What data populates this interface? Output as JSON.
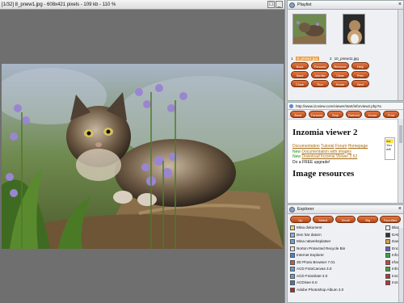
{
  "viewer": {
    "title": "[1/32] 8_pnew1.jpg - 608x421 pixels - 109 kb - 110 %"
  },
  "playlist": {
    "title": "Playlist",
    "thumbs": [
      {
        "index": "1",
        "name": "8_pnew1.jpg",
        "selected": true
      },
      {
        "index": "2",
        "name": "10_pnew11.jpg",
        "selected": false
      }
    ],
    "buttons_row1": [
      "Back",
      "Forward",
      "Remove",
      "Help"
    ],
    "buttons_row2": [
      "Save",
      "Add file",
      "Clear",
      "Prev"
    ],
    "buttons_row3": [
      "Close",
      "Run",
      "Home",
      "Next"
    ]
  },
  "browser": {
    "url": "http://www.izoview.com/viewer/start/inforview2.php?a",
    "nav_buttons": [
      "Back",
      "Forward",
      "Stop",
      "Refresh",
      "Home",
      "Print"
    ],
    "heading": "Inzomia viewer 2",
    "links_line1": [
      "Documentation",
      "Tutorial",
      "Forum",
      "Homepage"
    ],
    "new_label": "New",
    "new1": "Documentation with images",
    "new2": "Download Inzomia Viewer 2.52",
    "upgrade": "Do a FREE upgrade!",
    "sidebox": [
      "Inz",
      "You",
      "will"
    ],
    "heading2": "Image resources"
  },
  "explorer": {
    "title": "Explorer",
    "buttons": [
      "Up",
      "Select",
      "Small",
      "Big",
      "Favorites"
    ],
    "items": [
      "Mina dokument",
      "Den här datorn",
      "Mina nätverksplatser",
      "Norton Protected Recycle Bin",
      "Internet Explorer",
      "3D Photo Browser 7.01",
      "ACD FotoCanvas 3.0",
      "ACD FotoSlate 3.0",
      "ACDSee 6.0",
      "Adobe Photoshop Album 2.0"
    ],
    "items_col2": [
      "Blaze",
      "DAEM",
      "Dawn",
      "Encyc",
      "Infra",
      "Irfan",
      "InfraV",
      "Inzom",
      "Inzom"
    ]
  },
  "colors": {
    "pill": "#c85a24",
    "link": "#a56a12",
    "new": "#1e8a1e",
    "selected": "#f0a040"
  }
}
